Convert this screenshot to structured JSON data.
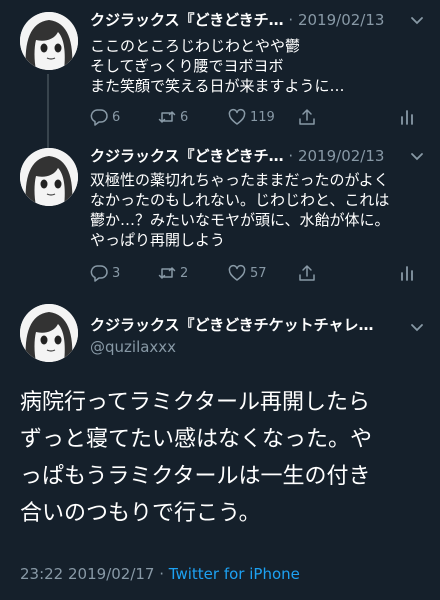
{
  "thread": [
    {
      "author_name": "クジラックス『どきどきチ…",
      "separator": " · ",
      "date": "2019/02/13",
      "lines": [
        "ここのところじわじわとやや鬱",
        "そしてぎっくり腰でヨボヨボ",
        "また笑顔で笑える日が来ますように…"
      ],
      "replies": "6",
      "retweets": "6",
      "likes": "119"
    },
    {
      "author_name": "クジラックス『どきどきチ…",
      "separator": " · ",
      "date": "2019/02/13",
      "lines": [
        "双極性の薬切れちゃったままだったのがよく",
        "なかったのもしれない。じわじわと、これは",
        "鬱か…？みたいなモヤが頭に、水飴が体に。",
        "やっぱり再開しよう"
      ],
      "replies": "3",
      "retweets": "2",
      "likes": "57"
    }
  ],
  "main_tweet": {
    "author_name": "クジラックス『どきどきチケットチャレ…",
    "handle": "@quzilaxxx",
    "lines": [
      "病院行ってラミクタール再開したら",
      "ずっと寝てたい感はなくなった。や",
      "っぱもうラミクタールは一生の付き",
      "合いのつもりで行こう。"
    ],
    "time": "23:22",
    "date": "2019/02/17",
    "separator": " · ",
    "via": "Twitter for iPhone"
  },
  "colors": {
    "background": "#15202b",
    "secondary_text": "#8899a6",
    "link": "#1da1f2"
  },
  "icons": {
    "reply": "reply-icon",
    "retweet": "retweet-icon",
    "like": "heart-icon",
    "share": "share-icon",
    "analytics": "analytics-icon",
    "more": "chevron-down-icon"
  }
}
